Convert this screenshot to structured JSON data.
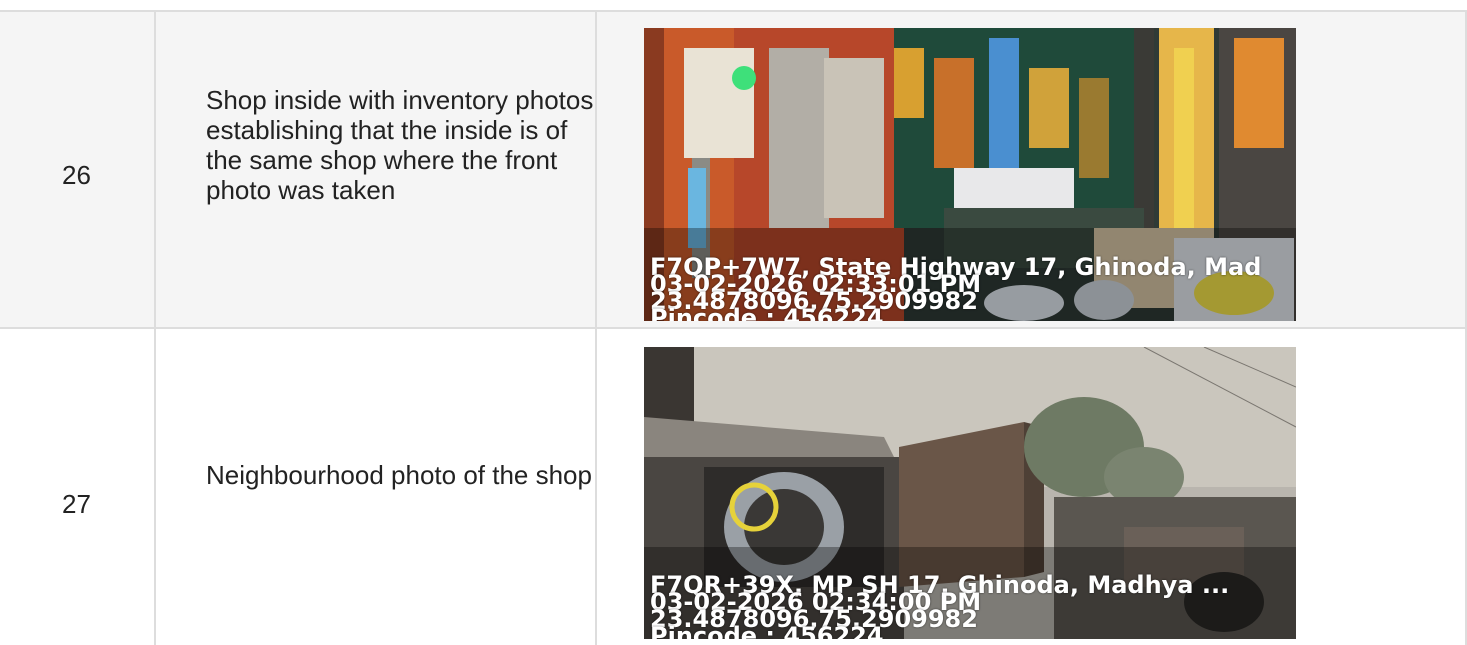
{
  "rows": [
    {
      "number": "26",
      "description": "Shop inside with inventory photos establishing that the inside is of the same shop where the front photo was taken",
      "photo": {
        "address": "F7QP+7W7, State Highway 17, Ghinoda, Mad",
        "datetime": "03-02-2026 02:33:01 PM",
        "coordinates": "23.4878096,75.2909982",
        "pincode": "Pincode : 456224"
      }
    },
    {
      "number": "27",
      "description": "Neighbourhood photo of the shop",
      "photo": {
        "address": "F7QR+39X, MP SH 17, Ghinoda, Madhya ...",
        "datetime": "03-02-2026 02:34:00 PM",
        "coordinates": "23.4878096,75.2909982",
        "pincode": "Pincode : 456224"
      }
    }
  ]
}
